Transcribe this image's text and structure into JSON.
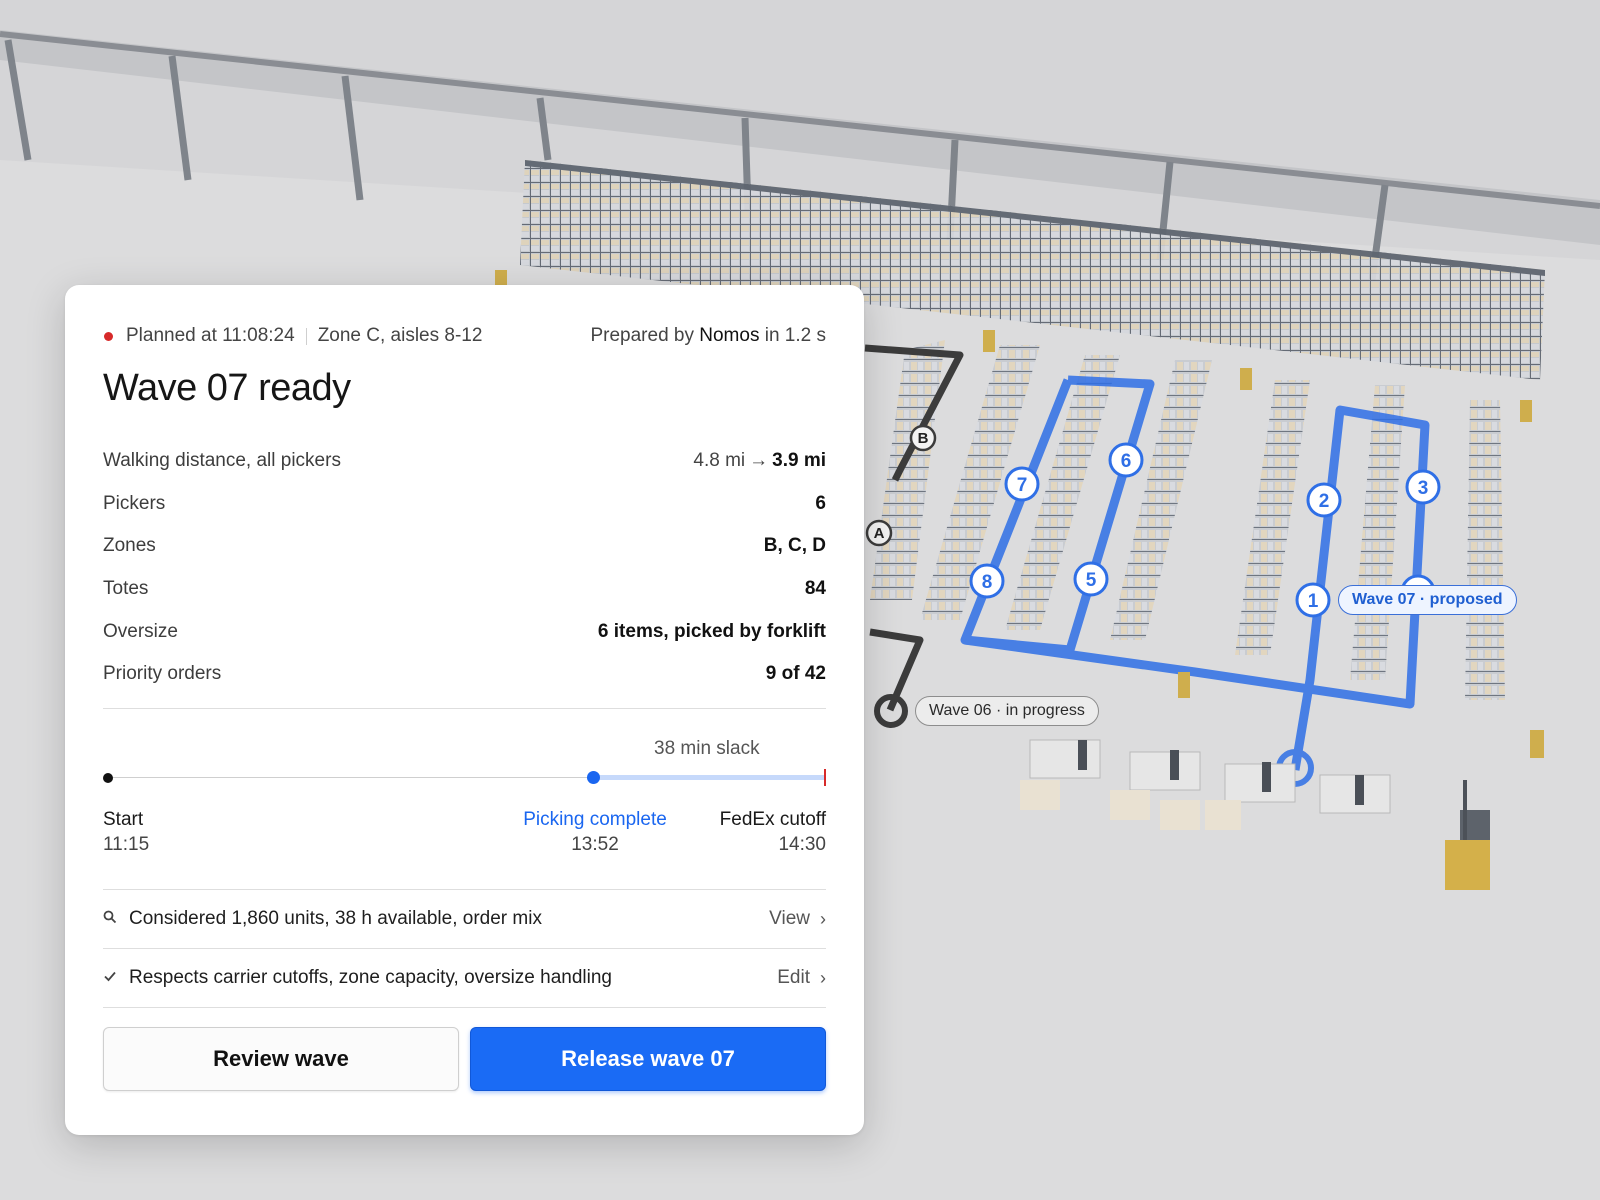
{
  "scene": {
    "wave06_label": "Wave 06 · in progress",
    "wave07_label": "Wave 07 · proposed",
    "stops": [
      "1",
      "2",
      "3",
      "4",
      "5",
      "6",
      "7",
      "8"
    ],
    "markers": [
      "A",
      "B"
    ],
    "colors": {
      "route": "#2f6fe6",
      "floor": "#dcdcdd",
      "wall": "#c9c9cb"
    }
  },
  "card": {
    "status_color": "#d72a2a",
    "planned_at": "Planned at 11:08:24",
    "zone": "Zone C, aisles 8-12",
    "prepared_prefix": "Prepared by",
    "agent": "Nomos",
    "prepared_suffix": "in 1.2 s",
    "title": "Wave 07 ready",
    "stats": [
      {
        "label": "Walking distance, all pickers",
        "from": "4.8 mi",
        "arrow": "→",
        "value": "3.9 mi"
      },
      {
        "label": "Pickers",
        "value": "6"
      },
      {
        "label": "Zones",
        "value": "B, C, D"
      },
      {
        "label": "Totes",
        "value": "84"
      },
      {
        "label": "Oversize",
        "value": "6 items, picked by forklift"
      },
      {
        "label": "Priority orders",
        "value": "9 of 42"
      }
    ],
    "timeline": {
      "slack": "38 min slack",
      "start_label": "Start",
      "start_time": "11:15",
      "pick_label": "Picking complete",
      "pick_time": "13:52",
      "cutoff_label": "FedEx cutoff",
      "cutoff_time": "14:30",
      "accent": "#1a66f0"
    },
    "rows": [
      {
        "icon": "search-icon",
        "text": "Considered 1,860 units, 38 h available, order mix",
        "action": "View"
      },
      {
        "icon": "check-icon",
        "text": "Respects carrier cutoffs, zone capacity, oversize handling",
        "action": "Edit"
      }
    ],
    "buttons": {
      "review": "Review wave",
      "release": "Release wave 07",
      "release_color": "#1a6bf5"
    }
  }
}
